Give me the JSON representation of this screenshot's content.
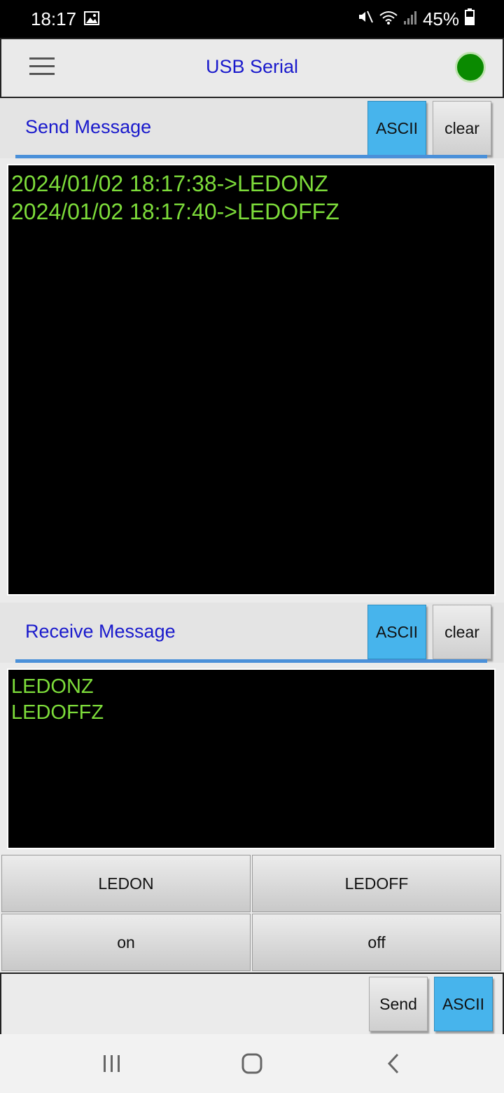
{
  "status_bar": {
    "time": "18:17",
    "battery": "45%"
  },
  "app_bar": {
    "title": "USB Serial",
    "connection_color": "#0a8a00"
  },
  "send_section": {
    "label": "Send Message",
    "mode_label": "ASCII",
    "clear_label": "clear",
    "log": [
      "2024/01/02 18:17:38->LEDONZ",
      "2024/01/02 18:17:40->LEDOFFZ"
    ]
  },
  "receive_section": {
    "label": "Receive Message",
    "mode_label": "ASCII",
    "clear_label": "clear",
    "log": [
      "LEDONZ",
      "LEDOFFZ"
    ]
  },
  "macros": [
    {
      "label": "LEDON"
    },
    {
      "label": "LEDOFF"
    },
    {
      "label": "on"
    },
    {
      "label": "off"
    }
  ],
  "input_bar": {
    "value": "",
    "send_label": "Send",
    "mode_label": "ASCII"
  },
  "colors": {
    "accent": "#47b4ec",
    "title": "#1a1acc",
    "terminal_text": "#7ddc3a"
  }
}
